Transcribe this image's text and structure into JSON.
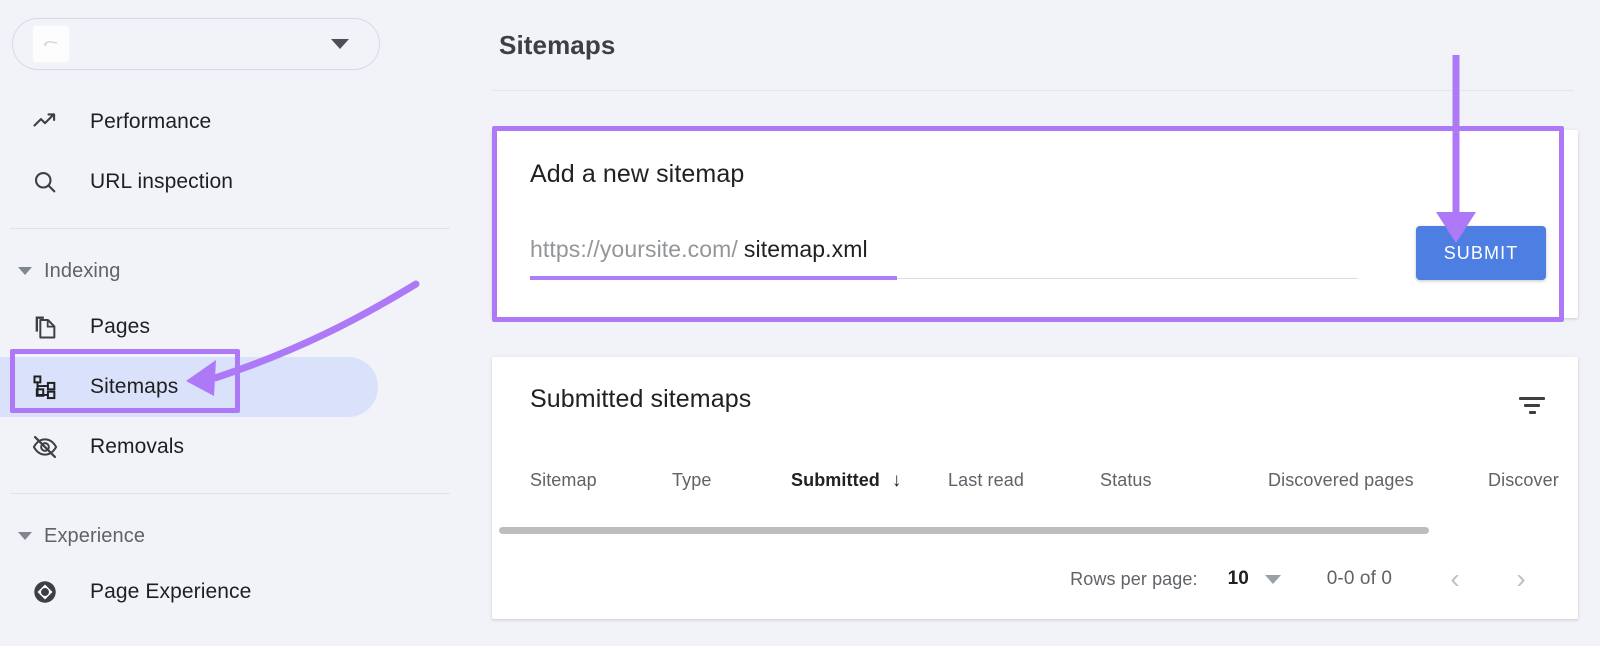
{
  "sidebar": {
    "property_selector": {
      "icon": "site-favicon",
      "caret_icon": "chevron-down-icon",
      "value": ""
    },
    "items": [
      {
        "label": "Performance",
        "icon": "trending-up-icon",
        "active": false
      },
      {
        "label": "URL inspection",
        "icon": "search-icon",
        "active": false
      }
    ],
    "groups": [
      {
        "title": "Indexing",
        "caret_icon": "chevron-down-icon",
        "items": [
          {
            "label": "Pages",
            "icon": "pages-copy-icon",
            "active": false
          },
          {
            "label": "Sitemaps",
            "icon": "sitemap-tree-icon",
            "active": true
          },
          {
            "label": "Removals",
            "icon": "eye-off-icon",
            "active": false
          }
        ]
      },
      {
        "title": "Experience",
        "caret_icon": "chevron-down-icon",
        "items": [
          {
            "label": "Page Experience",
            "icon": "page-experience-diamond-icon",
            "active": false
          }
        ]
      }
    ]
  },
  "main": {
    "page_title": "Sitemaps",
    "add_sitemap": {
      "title": "Add a new sitemap",
      "url_prefix": "https://yoursite.com/",
      "url_value": "sitemap.xml",
      "url_placeholder": "sitemap.xml",
      "submit_label": "SUBMIT"
    },
    "submitted_sitemaps": {
      "title": "Submitted sitemaps",
      "filter_icon": "filter-list-icon",
      "columns": [
        {
          "label": "Sitemap",
          "sorted": false
        },
        {
          "label": "Type",
          "sorted": false
        },
        {
          "label": "Submitted",
          "sorted": true,
          "sort_icon": "arrow-down-icon"
        },
        {
          "label": "Last read",
          "sorted": false
        },
        {
          "label": "Status",
          "sorted": false
        },
        {
          "label": "Discovered pages",
          "sorted": false
        },
        {
          "label": "Discover",
          "sorted": false
        }
      ],
      "rows": [],
      "pagination": {
        "rows_per_page_label": "Rows per page:",
        "rows_per_page_value": "10",
        "rows_per_page_caret": "chevron-down-icon",
        "range": "0-0 of 0",
        "prev_icon": "chevron-left-icon",
        "next_icon": "chevron-right-icon"
      }
    }
  },
  "annotations": {
    "accent_purple": "#ad79f7",
    "highlight_boxes": [
      {
        "target": "sidebar-item-sitemaps"
      },
      {
        "target": "add-a-new-sitemap-card"
      }
    ],
    "arrows": [
      {
        "name": "curved-arrow-to-sitemaps",
        "points_to": "Sitemaps"
      },
      {
        "name": "straight-arrow-to-submit",
        "points_to": "SUBMIT"
      }
    ]
  },
  "colors": {
    "submit_blue": "#4d7fe3",
    "active_pill": "#d9e1fb",
    "annotation_purple": "#ad79f7",
    "page_bg": "#f1f3f8",
    "card_bg": "#ffffff"
  }
}
